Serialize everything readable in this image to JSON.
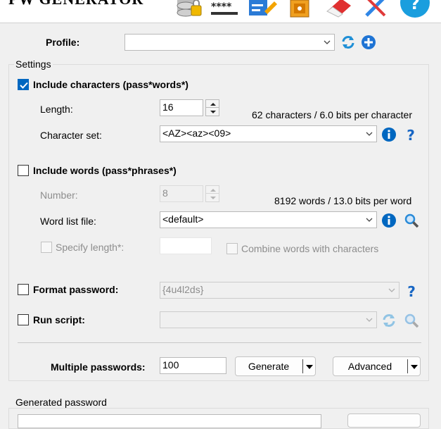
{
  "header": {
    "app_title": "PW GENERATOR",
    "icons": [
      "database-lock-icon",
      "password-dots-icon",
      "edit-icon",
      "vault-icon",
      "eraser-icon",
      "tools-icon",
      "help-icon"
    ],
    "accent": "#1a9ede"
  },
  "profile": {
    "label": "Profile:",
    "value": ""
  },
  "settings": {
    "group_label": "Settings",
    "include_characters": {
      "label": "Include characters (pass*words*)",
      "checked": true,
      "length_label": "Length:",
      "length_value": "16",
      "info": "62 characters / 6.0 bits per character",
      "charset_label": "Character set:",
      "charset_value": "<AZ><az><09>"
    },
    "include_words": {
      "label": "Include words (pass*phrases*)",
      "checked": false,
      "number_label": "Number:",
      "number_value": "8",
      "info": "8192 words / 13.0 bits per word",
      "wordlist_label": "Word list file:",
      "wordlist_value": "<default>",
      "specify_length_label": "Specify length*:",
      "specify_length_value": "",
      "combine_label": "Combine words with characters"
    },
    "format_password": {
      "label": "Format password:",
      "checked": false,
      "value": "{4u4l2ds}"
    },
    "run_script": {
      "label": "Run script:",
      "checked": false,
      "value": ""
    },
    "multiple": {
      "label": "Multiple passwords:",
      "value": "100",
      "generate_label": "Generate",
      "advanced_label": "Advanced"
    }
  },
  "generated": {
    "group_label": "Generated password",
    "value": ""
  },
  "colors": {
    "checkbox_checked": "#0067c0",
    "info_blue": "#0067c0",
    "help_blue": "#1866c4"
  }
}
